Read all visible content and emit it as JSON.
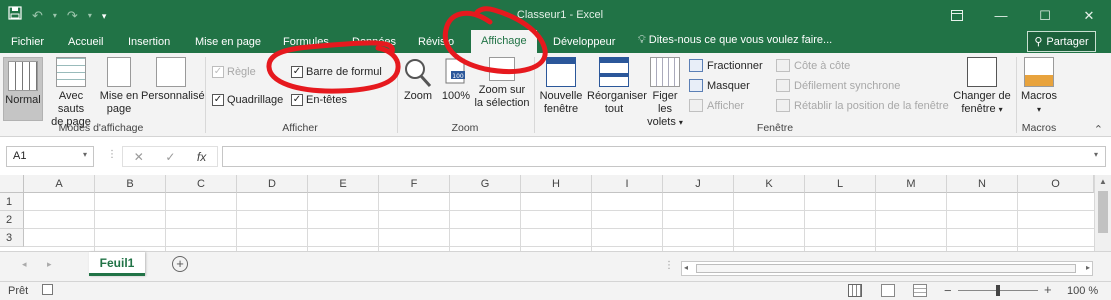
{
  "window": {
    "title": "Classeur1 - Excel",
    "accent": "#217346"
  },
  "tabs": [
    "Fichier",
    "Accueil",
    "Insertion",
    "Mise en page",
    "Formules",
    "Données",
    "Révisio",
    "Affichage",
    "Développeur"
  ],
  "active_tab": "Affichage",
  "tell_me": "Dites-nous ce que vous voulez faire...",
  "share_label": "Partager",
  "ribbon": {
    "modes": {
      "normal": "Normal",
      "sauts": [
        "Avec sauts",
        "de page"
      ],
      "mise": [
        "Mise en",
        "page"
      ],
      "perso": "Personnalisé",
      "label": "Modes d'affichage"
    },
    "afficher": {
      "regle": "Règle",
      "quadrillage": "Quadrillage",
      "barre": "Barre de formul",
      "entetes": "En-têtes",
      "label": "Afficher"
    },
    "zoom": {
      "zoom": "Zoom",
      "cent": "100%",
      "zoomsel": [
        "Zoom sur",
        "la sélection"
      ],
      "label": "Zoom"
    },
    "fenetre": {
      "nouvelle": [
        "Nouvelle",
        "fenêtre"
      ],
      "reorg": [
        "Réorganiser",
        "tout"
      ],
      "figer": [
        "Figer les",
        "volets"
      ],
      "fractionner": "Fractionner",
      "masquer": "Masquer",
      "afficher": "Afficher",
      "cote": "Côte à côte",
      "defil": "Défilement synchrone",
      "retablir": "Rétablir la position de la fenêtre",
      "label": "Fenêtre"
    },
    "changer": [
      "Changer de",
      "fenêtre"
    ],
    "macros": {
      "btn": "Macros",
      "label": "Macros"
    }
  },
  "formula_bar": {
    "name_box": "A1",
    "fx": "fx"
  },
  "columns": [
    "A",
    "B",
    "C",
    "D",
    "E",
    "F",
    "G",
    "H",
    "I",
    "J",
    "K",
    "L",
    "M",
    "N",
    "O"
  ],
  "rows": [
    "1",
    "2",
    "3"
  ],
  "sheet": {
    "tab": "Feuil1"
  },
  "status": {
    "ready": "Prêt",
    "zoom": "100 %"
  }
}
